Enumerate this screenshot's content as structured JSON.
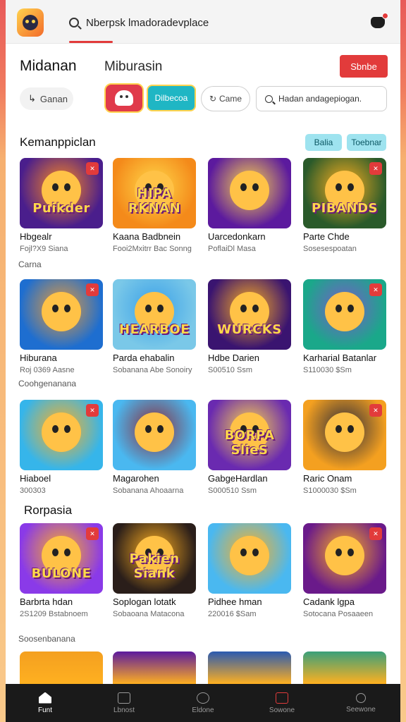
{
  "topbar": {
    "search_text": "Nberpsk lmadoradevplace",
    "icons": [
      "app-logo",
      "search-icon",
      "notification-icon"
    ]
  },
  "header": {
    "title": "Midanan",
    "subtitle": "Miburasin",
    "cta_label": "Sbnbe"
  },
  "filters": {
    "chip1": "Ganan",
    "chip_teal": "Dilbecoa",
    "chip_outline": "Came",
    "search_placeholder": "Hadan andagepiogan."
  },
  "section1": {
    "title": "Kemanppiclan",
    "pill_a": "Balia",
    "pill_b": "Toebnar"
  },
  "rows": [
    {
      "label": "",
      "cards": [
        {
          "art": "Puikder",
          "name": "Hbgealr",
          "sub": "Fojl?X9 Siana",
          "bg": "#4a1e8c",
          "accent": "#ff8a1e"
        },
        {
          "art": "HIPA RKNAN",
          "name": "Kaana Badbnein",
          "sub": "Fooi2Mxitrr Bac Sonng",
          "bg": "#f48a1a",
          "accent": "#ffd84a"
        },
        {
          "art": "",
          "name": "Uarcedonkarn",
          "sub": "PoflaiDl Masa",
          "bg": "#5c1a9e",
          "accent": "#ffd84a"
        },
        {
          "art": "PIBANDS",
          "name": "Parte Chde",
          "sub": "Sosesespoatan",
          "bg": "#2a5a2a",
          "accent": "#ffb020"
        }
      ]
    },
    {
      "label": "Carna",
      "cards": [
        {
          "art": "",
          "name": "Hiburana",
          "sub": "Roj 0369 Aasne",
          "bg": "#1e6ed0",
          "accent": "#e79b3a"
        },
        {
          "art": "HEARBOE",
          "name": "Parda ehabalin",
          "sub": "Sobanana Abe Sonoiry",
          "bg": "#7ac8e8",
          "accent": "#3aa0e8"
        },
        {
          "art": "WURCKS",
          "name": "Hdbe Darien",
          "sub": "S00510  Ssm",
          "bg": "#3a1470",
          "accent": "#ffb020"
        },
        {
          "art": "",
          "name": "Karharial Batanlar",
          "sub": "S110030  $Sm",
          "bg": "#1aa88a",
          "accent": "#7a5ac8"
        }
      ]
    },
    {
      "label": "Coohgenanana",
      "cards": [
        {
          "art": "",
          "name": "Hiaboel",
          "sub": "300303",
          "bg": "#36b5ea",
          "accent": "#ffb020"
        },
        {
          "art": "",
          "name": "Magarohen",
          "sub": "Sobanana Ahoaarna",
          "bg": "#4ab8f0",
          "accent": "#8a2a3a"
        },
        {
          "art": "BORPA SlieS",
          "name": "GabgeHardlan",
          "sub": "S000510  Ssm",
          "bg": "#6a2ab0",
          "accent": "#ffd84a"
        },
        {
          "art": "",
          "name": "Raric Onam",
          "sub": "S1000030  $Sm",
          "bg": "#f4a020",
          "accent": "#2a2a3a"
        }
      ]
    },
    {
      "label": "",
      "cards": [
        {
          "art": "BULONE",
          "name": "Barbrta hdan",
          "sub": "2S1209 Bstabnoem",
          "bg": "#8a3ae8",
          "accent": "#ffb020"
        },
        {
          "art": "Pakien Siank",
          "name": "Soplogan lotatk",
          "sub": "Sobaoana Matacona",
          "bg": "#2a1e1a",
          "accent": "#ffb020"
        },
        {
          "art": "",
          "name": "Pidhee hman",
          "sub": "220016  $Sam",
          "bg": "#4ab8f0",
          "accent": "#ffb020"
        },
        {
          "art": "",
          "name": "Cadank lgpa",
          "sub": "Sotocana  Posaaeen",
          "bg": "#6a1a8a",
          "accent": "#ffb020"
        }
      ]
    }
  ],
  "section2": {
    "title": "Rorpasia",
    "row_label": "Soosenbanana"
  },
  "bottomnav": {
    "items": [
      {
        "label": "Funt",
        "icon": "home-icon"
      },
      {
        "label": "Lbnost",
        "icon": "book-icon"
      },
      {
        "label": "Eldone",
        "icon": "chat-icon"
      },
      {
        "label": "Sowone",
        "icon": "bag-icon"
      },
      {
        "label": "Seewone",
        "icon": "search-icon"
      }
    ]
  }
}
